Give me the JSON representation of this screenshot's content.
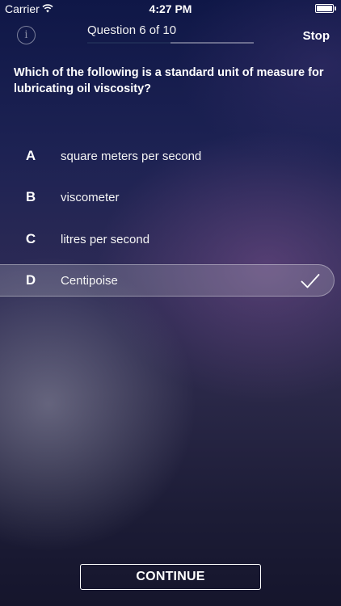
{
  "status_bar": {
    "carrier": "Carrier",
    "time": "4:27 PM",
    "battery_level": 1.0
  },
  "header": {
    "info_icon": "info-icon",
    "info_glyph": "i",
    "question_counter": "Question 6 of 10",
    "progress": 0.5,
    "stop_label": "Stop"
  },
  "question": {
    "text": "Which of the following is a standard unit of measure for lubricating oil viscosity?"
  },
  "answers": [
    {
      "letter": "A",
      "text": "square meters per second",
      "selected": false
    },
    {
      "letter": "B",
      "text": "viscometer",
      "selected": false
    },
    {
      "letter": "C",
      "text": "litres per second",
      "selected": false
    },
    {
      "letter": "D",
      "text": "Centipoise",
      "selected": true
    }
  ],
  "selected_icon": "checkmark-icon",
  "footer": {
    "continue_label": "CONTINUE"
  }
}
